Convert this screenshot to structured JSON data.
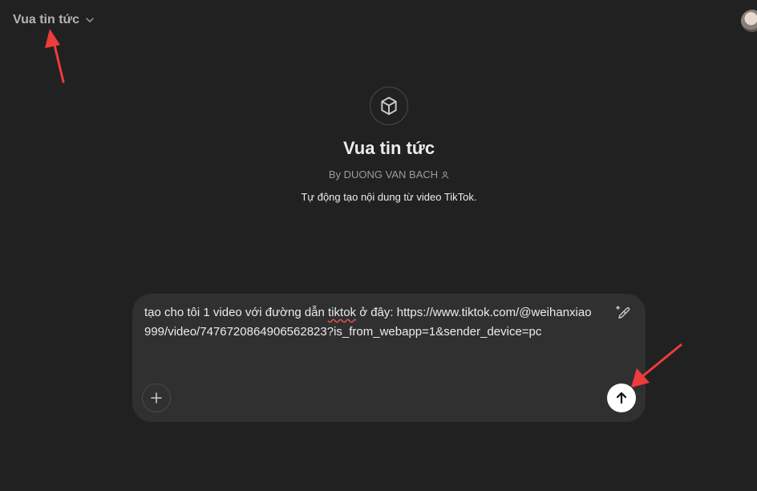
{
  "header": {
    "gpt_title": "Vua tin tức"
  },
  "gpt": {
    "name": "Vua tin tức",
    "author": "By DUONG VAN BACH",
    "description": "Tự động tạo nội dung từ video TikTok."
  },
  "composer": {
    "text_before": "tạo cho tôi 1 video với đường dẫn ",
    "text_misspelled": "tiktok",
    "text_after": " ở đây: https://www.tiktok.com/@weihanxiao999/video/7476720864906562823?is_from_webapp=1&sender_device=pc"
  },
  "icons": {
    "chevron": "chevron-down-icon",
    "gpt": "cube-icon",
    "person": "person-icon",
    "edit": "pen-sparkle-icon",
    "add": "plus-icon",
    "send": "arrow-up-icon"
  },
  "colors": {
    "background": "#212121",
    "composer": "#303030",
    "annotation": "#ef3b3b"
  }
}
